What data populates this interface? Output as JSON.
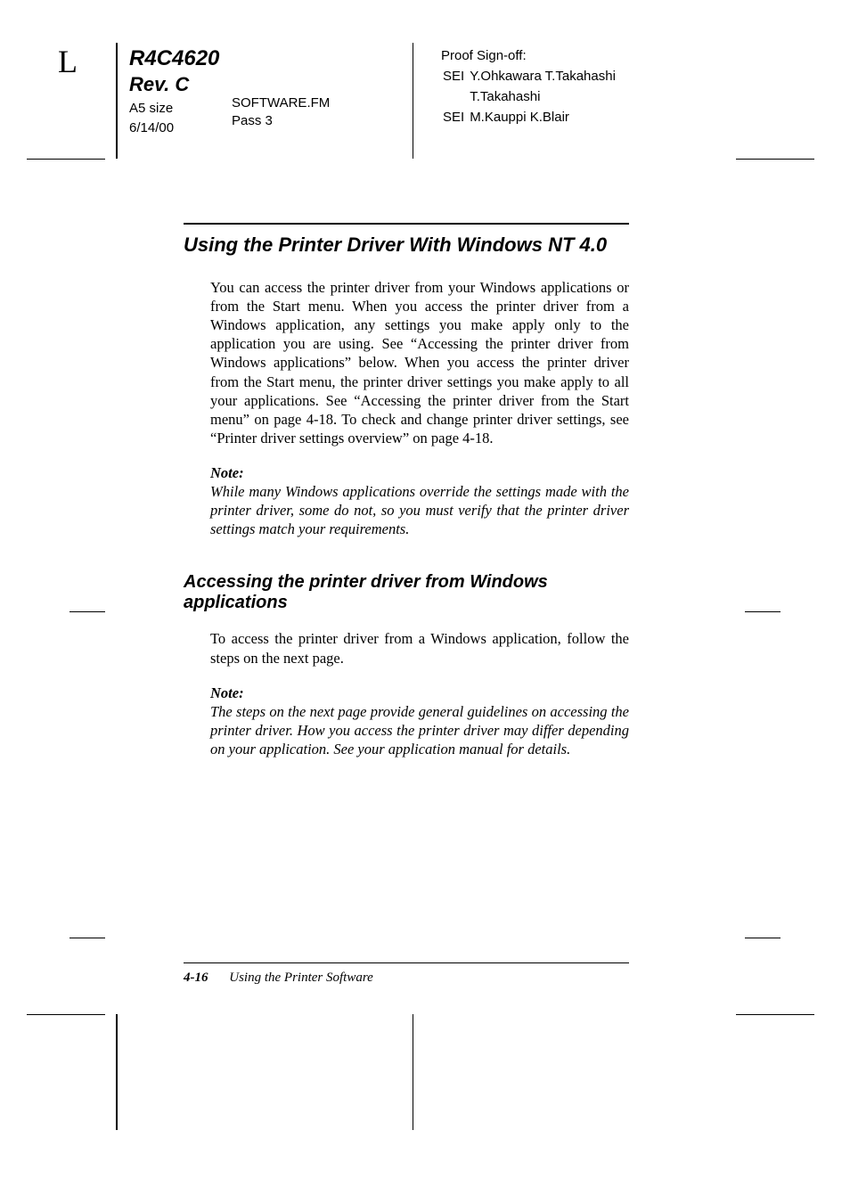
{
  "header": {
    "l_mark": "L",
    "docnum": "R4C4620",
    "rev": "Rev. C",
    "size": "A5 size",
    "date": "6/14/00",
    "file": "SOFTWARE.FM",
    "pass": "Pass 3",
    "proof_label": "Proof Sign-off:",
    "row1_a": "SEI",
    "row1_b": "Y.Ohkawara T.Takahashi",
    "row2_b": "T.Takahashi",
    "row3_a": "SEI",
    "row3_b": "M.Kauppi K.Blair"
  },
  "section": {
    "title": "Using the Printer Driver With Windows NT 4.0",
    "para1": "You can access the printer driver from your Windows applications or from the Start menu. When you access the printer driver from a Windows application, any settings you make apply only to the application you are using. See “Accessing the printer driver from Windows applications” below. When you access the printer driver from the Start menu, the printer driver settings you make apply to all your applications. See “Accessing the printer driver from the Start menu” on page 4-18. To check and change printer driver settings, see “Printer driver settings overview” on page 4-18.",
    "note1_label": "Note:",
    "note1_text": "While many Windows applications override the settings made with the printer driver, some do not, so you must verify that the printer driver settings match your requirements.",
    "subtitle": "Accessing the printer driver from Windows applications",
    "para2": "To access the printer driver from a Windows application, follow the steps on the next page.",
    "note2_label": "Note:",
    "note2_text": "The steps on the next page provide general guidelines on accessing the printer driver. How you access the printer driver may differ depending on your application. See your application manual for details."
  },
  "footer": {
    "page": "4-16",
    "chapter": "Using the Printer Software"
  }
}
